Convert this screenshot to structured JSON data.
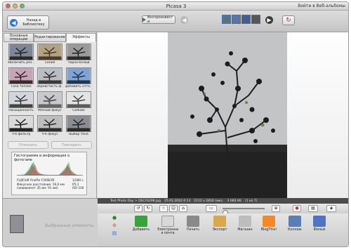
{
  "window": {
    "title": "Picasa 3",
    "signin": "Войти в Веб-альбомы"
  },
  "toolbar": {
    "back_label": "Назад в Библиотеку",
    "slideshow_label": "Воспроизвест и"
  },
  "tabs": [
    {
      "label": "Основные операции"
    },
    {
      "label": "Редактирование"
    },
    {
      "label": "Эффекты"
    }
  ],
  "effects": [
    {
      "label": "Увеличить рез..."
    },
    {
      "label": "Сепия"
    },
    {
      "label": "Черно-белый"
    },
    {
      "label": "Тона теплее"
    },
    {
      "label": "Зернистость ф..."
    },
    {
      "label": "Добавить отте..."
    },
    {
      "label": "Насыщенность"
    },
    {
      "label": "Мягкий фокус"
    },
    {
      "label": "Сияние"
    },
    {
      "label": "Ч-б фильтр"
    },
    {
      "label": "Ч-б фокус"
    },
    {
      "label": "Выбор тона"
    }
  ],
  "actions": {
    "cancel": "Отменить",
    "redo": "Повторить"
  },
  "histogram": {
    "title": "Гистограмма и информация о фотогаме",
    "camera": "FUJIFILM FinePix F300EXR",
    "focus": "Фокусное расстояние: 16,0 мм",
    "equiv": "(эквивалент 35 мм: 91 мм)",
    "shutter": "1/280 с.",
    "aperture": "f/5.1",
    "iso": "ISO 100"
  },
  "infobar": {
    "album": "Test Photo Day > DSCF6298.jpg",
    "date": "25.01.2010 4:13",
    "size": "2112 x 2816 пикс.",
    "filesize": "3 083 Кб",
    "index": "(1 из 7)"
  },
  "tray": {
    "label": "Выбранные элементы"
  },
  "bottom_actions": [
    {
      "label": "Добавить",
      "icon": "upload-icon",
      "color": "#3aa23a"
    },
    {
      "label": "Электронна я почта",
      "icon": "email-icon",
      "color": "#d8d8d8"
    },
    {
      "label": "Печать",
      "icon": "print-icon",
      "color": "#8a8a8a"
    },
    {
      "label": "Экспорт",
      "icon": "folder-icon",
      "color": "#d8a94a"
    },
    {
      "label": "Магазин",
      "icon": "shop-icon",
      "color": "#bdbdbd"
    },
    {
      "label": "BlogThis!",
      "icon": "blogger-icon",
      "color": "#f08a24"
    },
    {
      "label": "Коллаж",
      "icon": "collage-icon",
      "color": "#5a7fb4"
    },
    {
      "label": "Фильм",
      "icon": "movie-icon",
      "color": "#4f74c2"
    }
  ]
}
